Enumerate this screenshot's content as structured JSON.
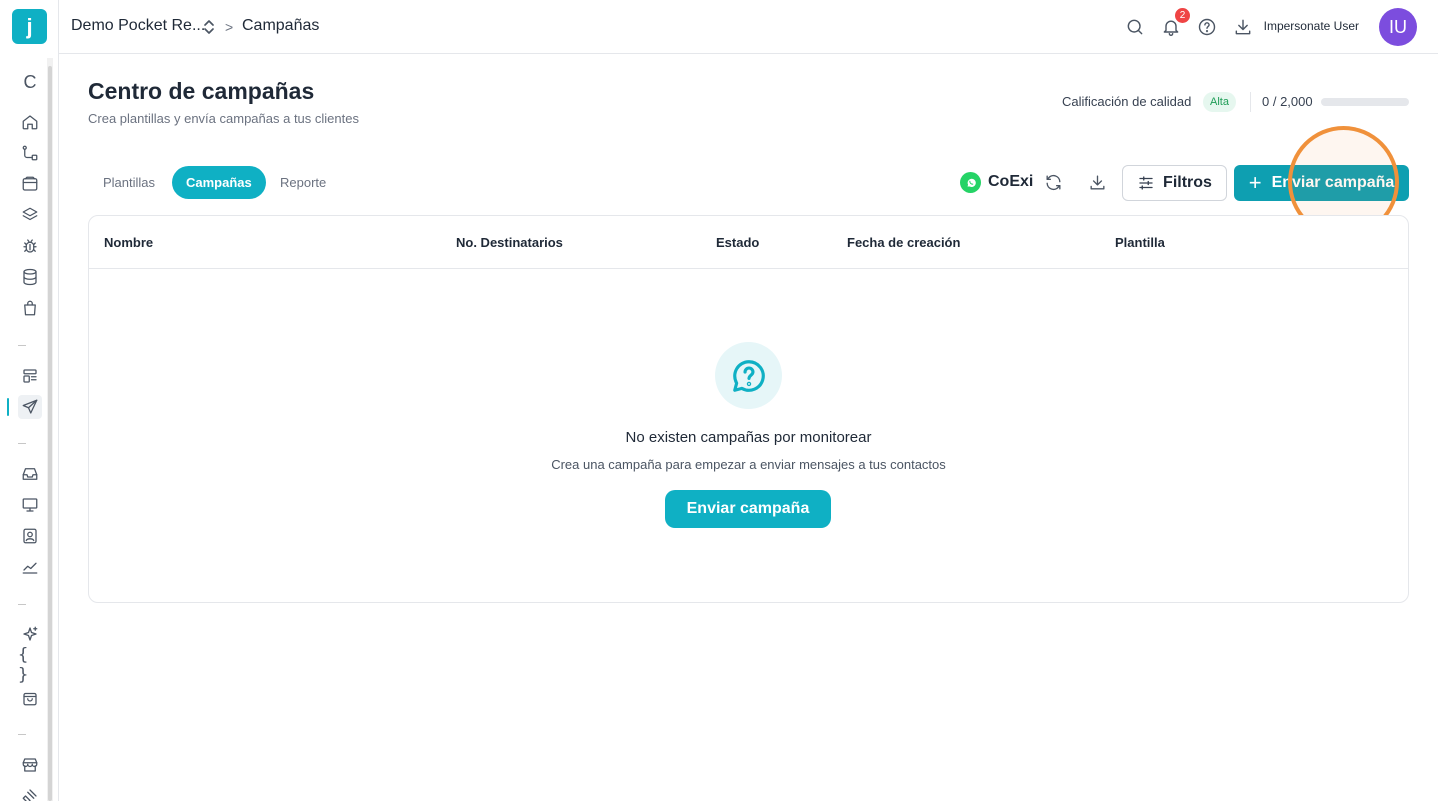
{
  "app": {
    "logo_letter": "j"
  },
  "header": {
    "workspace": "Demo Pocket Re...",
    "breadcrumb_separator": ">",
    "page": "Campañas",
    "notifications_count": "2",
    "user_name": "Impersonate User",
    "avatar_initials": "IU"
  },
  "sidebar": {
    "top_letter": "C",
    "icons": [
      "home-icon",
      "flow-icon",
      "inbox-tray-icon",
      "layers-icon",
      "bug-icon",
      "database-icon",
      "shopping-bag-icon",
      "templates-icon",
      "send-icon",
      "inbox-icon",
      "monitor-icon",
      "contact-icon",
      "chart-icon",
      "sparkles-icon",
      "code-braces-icon",
      "store-bag-icon",
      "storefront-icon",
      "plug-icon"
    ],
    "active": "send-icon"
  },
  "main": {
    "title": "Centro de campañas",
    "subtitle": "Crea plantillas y envía campañas a tus clientes",
    "quality_label": "Calificación de calidad",
    "quality_value": "Alta",
    "quota_text": "0 / 2,000",
    "quota_fraction": 0,
    "tabs": [
      {
        "label": "Plantillas",
        "active": false
      },
      {
        "label": "Campañas",
        "active": true
      },
      {
        "label": "Reporte",
        "active": false
      }
    ],
    "channel_name": "CoExi",
    "filters_label": "Filtros",
    "send_label": "Enviar campaña",
    "table": {
      "columns": [
        "Nombre",
        "No. Destinatarios",
        "Estado",
        "Fecha de creación",
        "Plantilla"
      ],
      "rows": []
    },
    "empty": {
      "title": "No existen campañas por monitorear",
      "subtitle": "Crea una campaña para empezar a enviar mensajes a tus contactos",
      "button": "Enviar campaña"
    }
  },
  "colors": {
    "accent": "#0fb0c4",
    "send_button": "#0e9fb1",
    "avatar": "#7c4dde",
    "badge": "#ef4444",
    "highlight": "#f0913b"
  }
}
